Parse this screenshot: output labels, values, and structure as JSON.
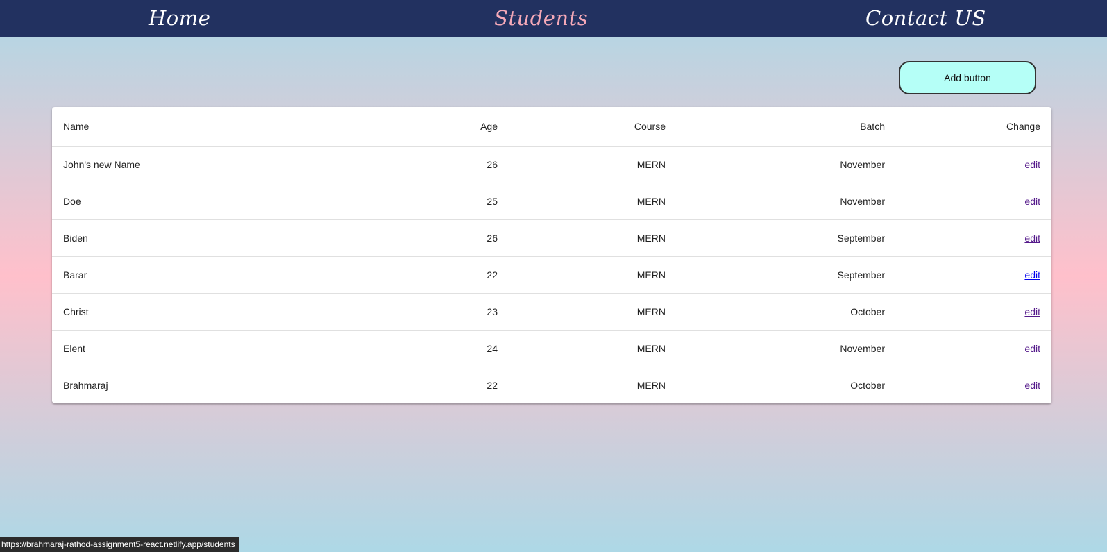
{
  "nav": {
    "home": "Home",
    "students": "Students",
    "contact": "Contact US"
  },
  "add_button": "Add button",
  "table": {
    "headers": [
      "Name",
      "Age",
      "Course",
      "Batch",
      "Change"
    ],
    "rows": [
      {
        "name": "John's new Name",
        "age": "26",
        "course": "MERN",
        "batch": "November",
        "change": "edit"
      },
      {
        "name": "Doe",
        "age": "25",
        "course": "MERN",
        "batch": "November",
        "change": "edit"
      },
      {
        "name": "Biden",
        "age": "26",
        "course": "MERN",
        "batch": "September",
        "change": "edit"
      },
      {
        "name": "Barar",
        "age": "22",
        "course": "MERN",
        "batch": "September",
        "change": "edit"
      },
      {
        "name": "Christ",
        "age": "23",
        "course": "MERN",
        "batch": "October",
        "change": "edit"
      },
      {
        "name": "Elent",
        "age": "24",
        "course": "MERN",
        "batch": "November",
        "change": "edit"
      },
      {
        "name": "Brahmaraj",
        "age": "22",
        "course": "MERN",
        "batch": "October",
        "change": "edit"
      }
    ]
  },
  "status_bar_url": "https://brahmaraj-rathod-assignment5-react.netlify.app/students",
  "colors": {
    "navbar": "#223160",
    "active_nav": "#f5a9b8",
    "add_button_bg": "#b5fff7"
  }
}
